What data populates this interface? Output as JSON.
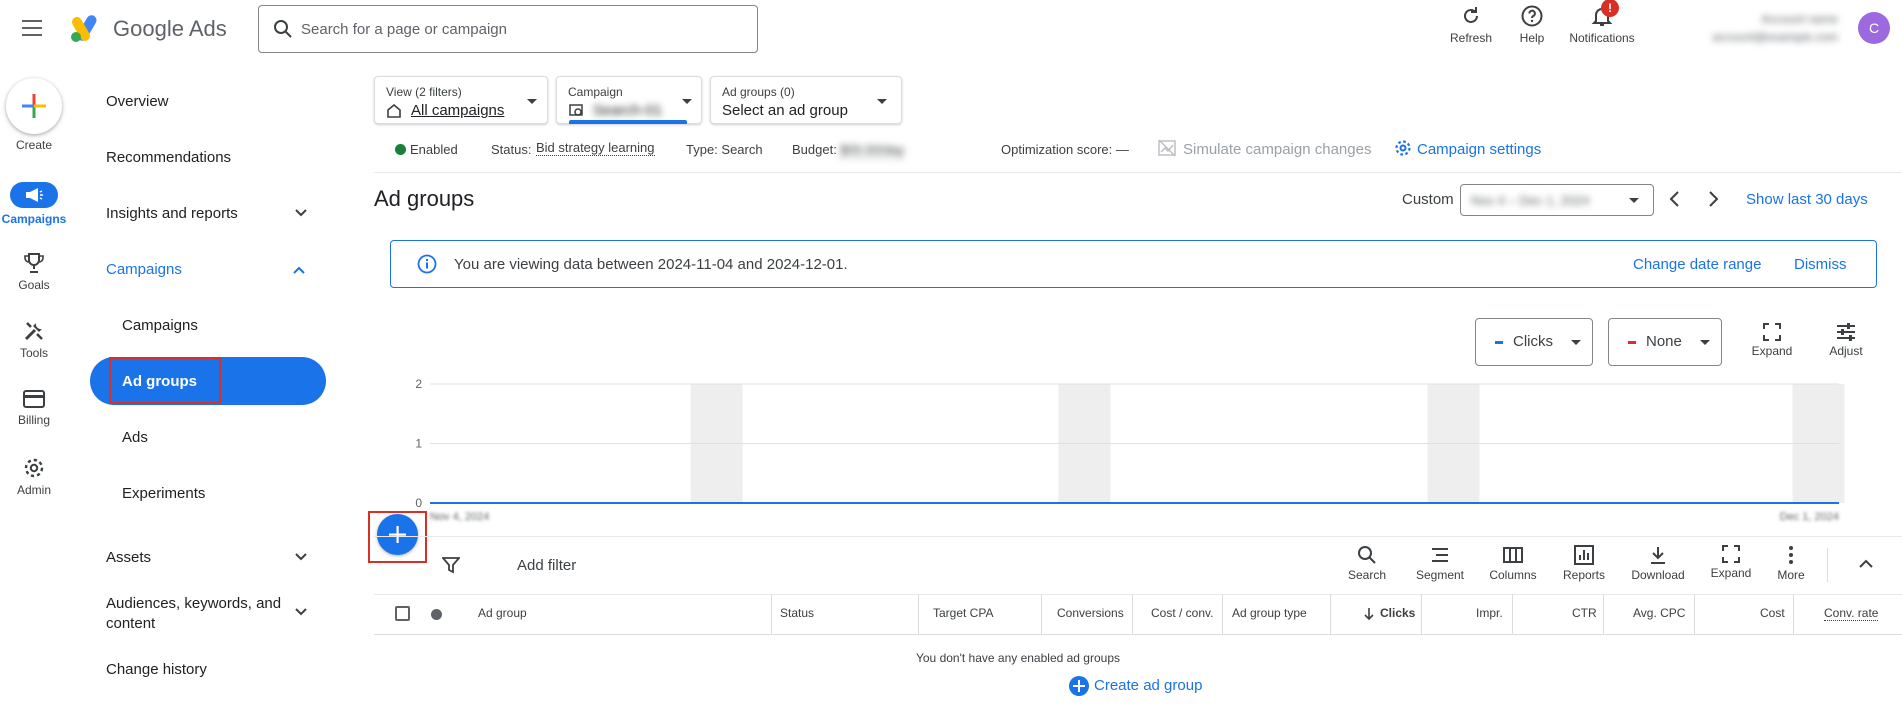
{
  "header": {
    "logo_text": "Google Ads",
    "search_placeholder": "Search for a page or campaign",
    "refresh_label": "Refresh",
    "help_label": "Help",
    "notifications_label": "Notifications",
    "notifications_badge": "!",
    "account_name": "Account name",
    "account_email": "account@example.com",
    "avatar_letter": "C"
  },
  "rail": {
    "create": "Create",
    "campaigns": "Campaigns",
    "goals": "Goals",
    "tools": "Tools",
    "billing": "Billing",
    "admin": "Admin"
  },
  "nav": {
    "overview": "Overview",
    "recommendations": "Recommendations",
    "insights": "Insights and reports",
    "campaigns_group": "Campaigns",
    "campaigns": "Campaigns",
    "ad_groups": "Ad groups",
    "ads": "Ads",
    "experiments": "Experiments",
    "assets": "Assets",
    "audiences": "Audiences, keywords, and content",
    "change_history": "Change history"
  },
  "selectors": {
    "view_small": "View (2 filters)",
    "view_big": "All campaigns",
    "campaign_small": "Campaign",
    "campaign_big": "Search-01",
    "adgroups_small": "Ad groups (0)",
    "adgroups_big": "Select an ad group"
  },
  "status": {
    "enabled": "Enabled",
    "status_label": "Status:",
    "status_value": "Bid strategy learning",
    "type": "Type: Search",
    "budget_label": "Budget:",
    "budget_value": "$00.00/day",
    "optimization": "Optimization score: —",
    "simulate": "Simulate campaign changes",
    "settings": "Campaign settings"
  },
  "page": {
    "title": "Ad groups",
    "custom_label": "Custom",
    "date_range": "Nov 4 – Dec 1, 2024",
    "show_last": "Show last 30 days"
  },
  "banner": {
    "text": "You are viewing data between 2024-11-04 and 2024-12-01.",
    "change": "Change date range",
    "dismiss": "Dismiss"
  },
  "chart_controls": {
    "metric1": "Clicks",
    "metric2": "None",
    "expand": "Expand",
    "adjust": "Adjust"
  },
  "chart_data": {
    "type": "line",
    "y_ticks": [
      "2",
      "1",
      "0"
    ],
    "ylim": [
      0,
      2
    ],
    "x_start_label": "Nov 4, 2024",
    "x_end_label": "Dec 1, 2024",
    "series": [
      {
        "values": [
          0,
          0
        ]
      }
    ],
    "grid": true
  },
  "table_toolbar": {
    "add_filter": "Add filter",
    "search": "Search",
    "segment": "Segment",
    "columns": "Columns",
    "reports": "Reports",
    "download": "Download",
    "expand": "Expand",
    "more": "More"
  },
  "table": {
    "headers": [
      "Ad group",
      "Status",
      "Target CPA",
      "Conversions",
      "Cost / conv.",
      "Ad group type",
      "Clicks",
      "Impr.",
      "CTR",
      "Avg. CPC",
      "Cost",
      "Conv. rate"
    ],
    "empty_text": "You don't have any enabled ad groups",
    "create_link": "Create ad group"
  },
  "colors": {
    "accent": "#1a73e8",
    "highlight_box": "#d93025",
    "enabled": "#188038"
  }
}
